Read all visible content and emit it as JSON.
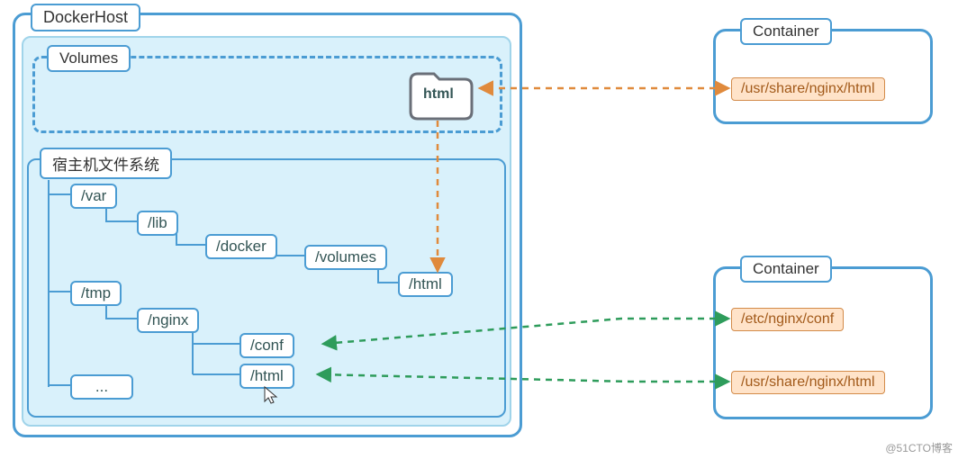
{
  "dockerHost": {
    "label": "DockerHost",
    "volumesLabel": "Volumes",
    "volumeIconLabel": "html",
    "fsLabel": "宿主机文件系统",
    "tree": {
      "var": "/var",
      "lib": "/lib",
      "docker": "/docker",
      "volumes": "/volumes",
      "html": "/html",
      "tmp": "/tmp",
      "nginx": "/nginx",
      "conf": "/conf",
      "html2": "/html",
      "ellipsis": "..."
    }
  },
  "container1": {
    "label": "Container",
    "paths": [
      "/usr/share/nginx/html"
    ]
  },
  "container2": {
    "label": "Container",
    "paths": [
      "/etc/nginx/conf",
      "/usr/share/nginx/html"
    ]
  },
  "watermark": "@51CTO博客",
  "colors": {
    "blue": "#4b9cd3",
    "lightblue": "#d9f1fb",
    "orange": "#e08a3c",
    "green": "#2e9c5b",
    "peach": "#ffe3c9"
  }
}
